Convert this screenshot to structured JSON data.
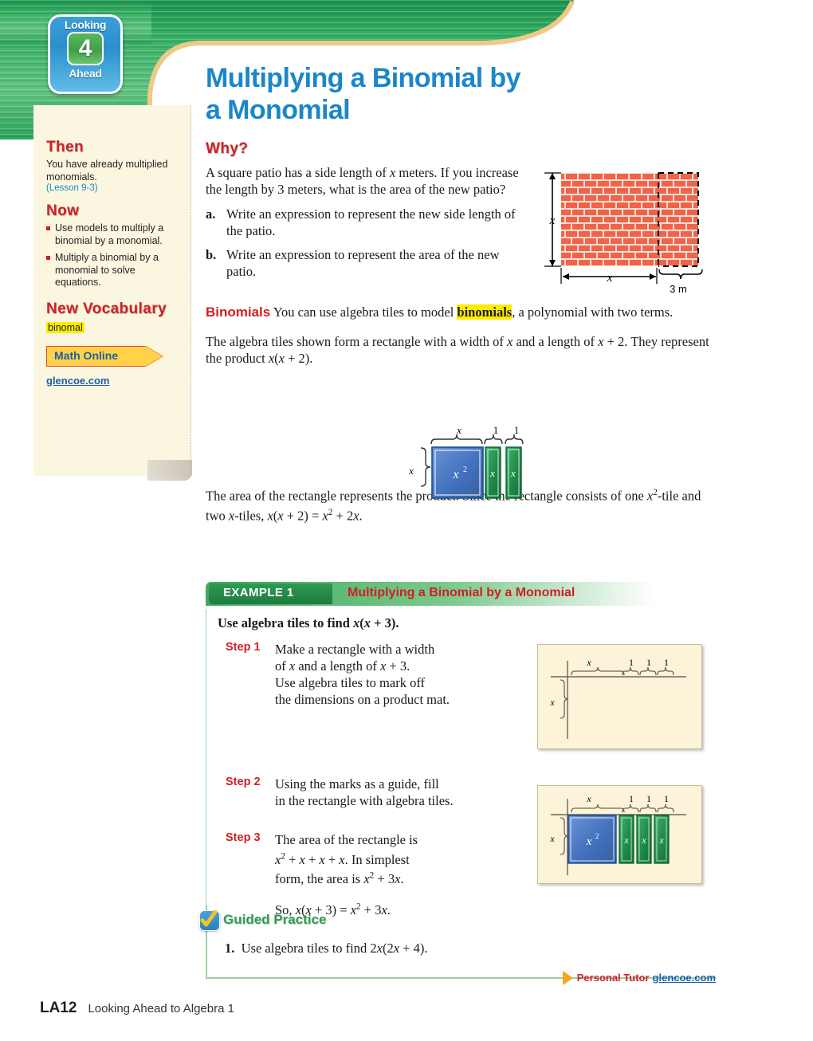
{
  "header": {
    "badge_top": "Looking",
    "badge_number": "4",
    "badge_bottom": "Ahead",
    "title_line1": "Multiplying a Binomial by",
    "title_line2": "a Monomial",
    "title_color": "#1b86c8"
  },
  "sidebar": {
    "then_heading": "Then",
    "then_text": "You have already multiplied monomials.",
    "then_lesson": "(Lesson 9-3)",
    "now_heading": "Now",
    "now_items": [
      "Use models to multiply a binomial by a monomial.",
      "Multiply a binomial by a monomial to solve equations."
    ],
    "vocab_heading": "New Vocabulary",
    "vocab_term": "binomal",
    "math_online_label": "Math Online",
    "math_online_link": "glencoe.com"
  },
  "why": {
    "heading": "Why?",
    "intro": "A square patio has a side length of x meters. If you increase the length by 3 meters, what is the area of the new patio?",
    "items": [
      {
        "letter": "a.",
        "text": "Write an expression to represent the new side length of the patio."
      },
      {
        "letter": "b.",
        "text": "Write an expression to represent the area of the new patio."
      }
    ]
  },
  "patio_figure": {
    "height_label": "x",
    "width_label": "x",
    "extension_label": "3 m",
    "brick_color": "#ef6449"
  },
  "binomials": {
    "section_head": "Binomials",
    "p1_before": " You can use algebra tiles to model ",
    "p1_term": "binomials",
    "p1_after": ", a polynomial with two terms.",
    "p2": "The algebra tiles shown form a rectangle with a width of x and a length of x + 2. They represent the product x(x + 2).",
    "p3": "The area of the rectangle represents the product. Since the rectangle consists of one x²-tile and two x-tiles, x(x + 2) = x² + 2x."
  },
  "tile_figure": {
    "top_labels": [
      "x",
      "1",
      "1"
    ],
    "left_label": "x",
    "square_label": "x",
    "square_exp": "2",
    "tile_labels": [
      "x",
      "x"
    ],
    "square_color": "#4371bd",
    "tile_color": "#1e8a47"
  },
  "example": {
    "tag": "EXAMPLE 1",
    "title": "Multiplying a Binomial by a Monomial",
    "prompt": "Use algebra tiles to find x(x + 3).",
    "steps": [
      {
        "label": "Step 1",
        "lines": [
          "Make a rectangle with a width",
          "of x and a length of x + 3.",
          "Use algebra tiles to mark off",
          "the dimensions on a product mat."
        ]
      },
      {
        "label": "Step 2",
        "lines": [
          "Using the marks as a guide, fill",
          "in the rectangle with algebra tiles."
        ]
      },
      {
        "label": "Step 3",
        "lines": [
          "The area of the rectangle is",
          "x² + x + x + x. In simplest",
          "form, the area is x² + 3x."
        ]
      }
    ],
    "conclusion": "So, x(x + 3) = x² + 3x."
  },
  "mat_empty": {
    "top_labels": [
      "x",
      "1",
      "1",
      "1"
    ],
    "left_label": "x",
    "background": "#fdf3d8"
  },
  "mat_filled": {
    "top_labels": [
      "x",
      "1",
      "1",
      "1"
    ],
    "left_label": "x",
    "square_label": "x",
    "square_exp": "2",
    "tile_labels": [
      "x",
      "x",
      "x"
    ],
    "background": "#fdf3d8"
  },
  "guided": {
    "title": "Guided Practice",
    "item_number": "1.",
    "item_text": "Use algebra tiles to find 2x(2x + 4).",
    "tutor_label": "Personal Tutor",
    "tutor_link": "glencoe.com"
  },
  "footer": {
    "page": "LA12",
    "text": "Looking Ahead to Algebra 1"
  }
}
